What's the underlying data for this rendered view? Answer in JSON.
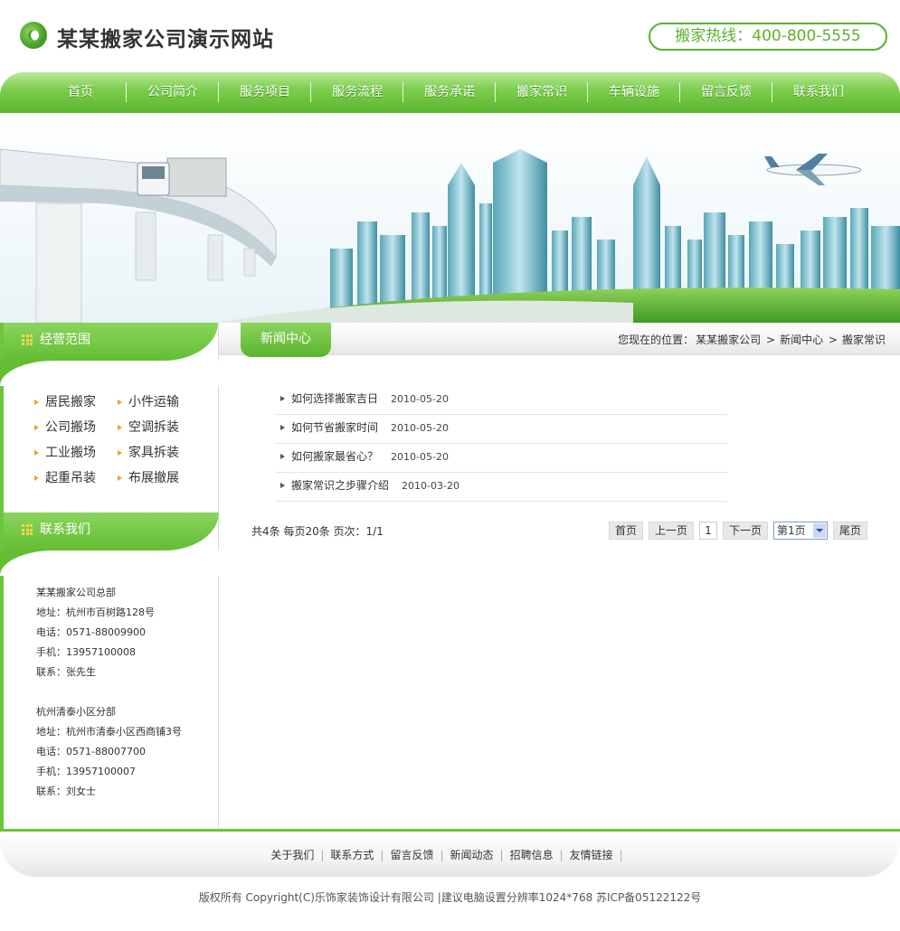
{
  "header": {
    "site_title": "某某搬家公司演示网站",
    "hotline": "搬家热线：400-800-5555"
  },
  "nav": {
    "items": [
      "首页",
      "公司简介",
      "服务项目",
      "服务流程",
      "服务承诺",
      "搬家常识",
      "车辆设施",
      "留言反馈",
      "联系我们"
    ]
  },
  "sidebar": {
    "services_title": "经营范围",
    "services": [
      "居民搬家",
      "小件运输",
      "公司搬场",
      "空调拆装",
      "工业搬场",
      "家具拆装",
      "起重吊装",
      "布展撤展"
    ],
    "contact_title": "联系我们",
    "branches": [
      {
        "name": "某某搬家公司总部",
        "address": "地址：杭州市百树路128号",
        "phone": "电话：0571-88009900",
        "mobile": "手机：13957100008",
        "contact": "联系：张先生"
      },
      {
        "name": "杭州清泰小区分部",
        "address": "地址：杭州市清泰小区西商铺3号",
        "phone": "电话：0571-88007700",
        "mobile": "手机：13957100007",
        "contact": "联系：刘女士"
      }
    ]
  },
  "main": {
    "tab_title": "新闻中心",
    "breadcrumb": {
      "prefix": "您现在的位置：",
      "home": "某某搬家公司",
      "level1": "新闻中心",
      "level2": "搬家常识",
      "sep": ">"
    },
    "news": [
      {
        "title": "如何选择搬家吉日",
        "date": "2010-05-20"
      },
      {
        "title": "如何节省搬家时间",
        "date": "2010-05-20"
      },
      {
        "title": "如何搬家最省心？",
        "date": "2010-05-20"
      },
      {
        "title": "搬家常识之步骤介绍",
        "date": "2010-03-20"
      }
    ],
    "pager": {
      "info": "共4条  每页20条  页次：1/1",
      "first": "首页",
      "prev": "上一页",
      "current": "1",
      "next": "下一页",
      "select_value": "第1页",
      "last": "尾页"
    }
  },
  "footer": {
    "links": [
      "关于我们",
      "联系方式",
      "留言反馈",
      "新闻动态",
      "招聘信息",
      "友情链接"
    ],
    "sep": "|",
    "copyright": "版权所有  Copyright(C)乐饰家装饰设计有限公司  |建议电脑设置分辨率1024*768 苏ICP备05122122号"
  },
  "colors": {
    "brand_green": "#6cc53a",
    "accent_orange": "#f0a020"
  }
}
